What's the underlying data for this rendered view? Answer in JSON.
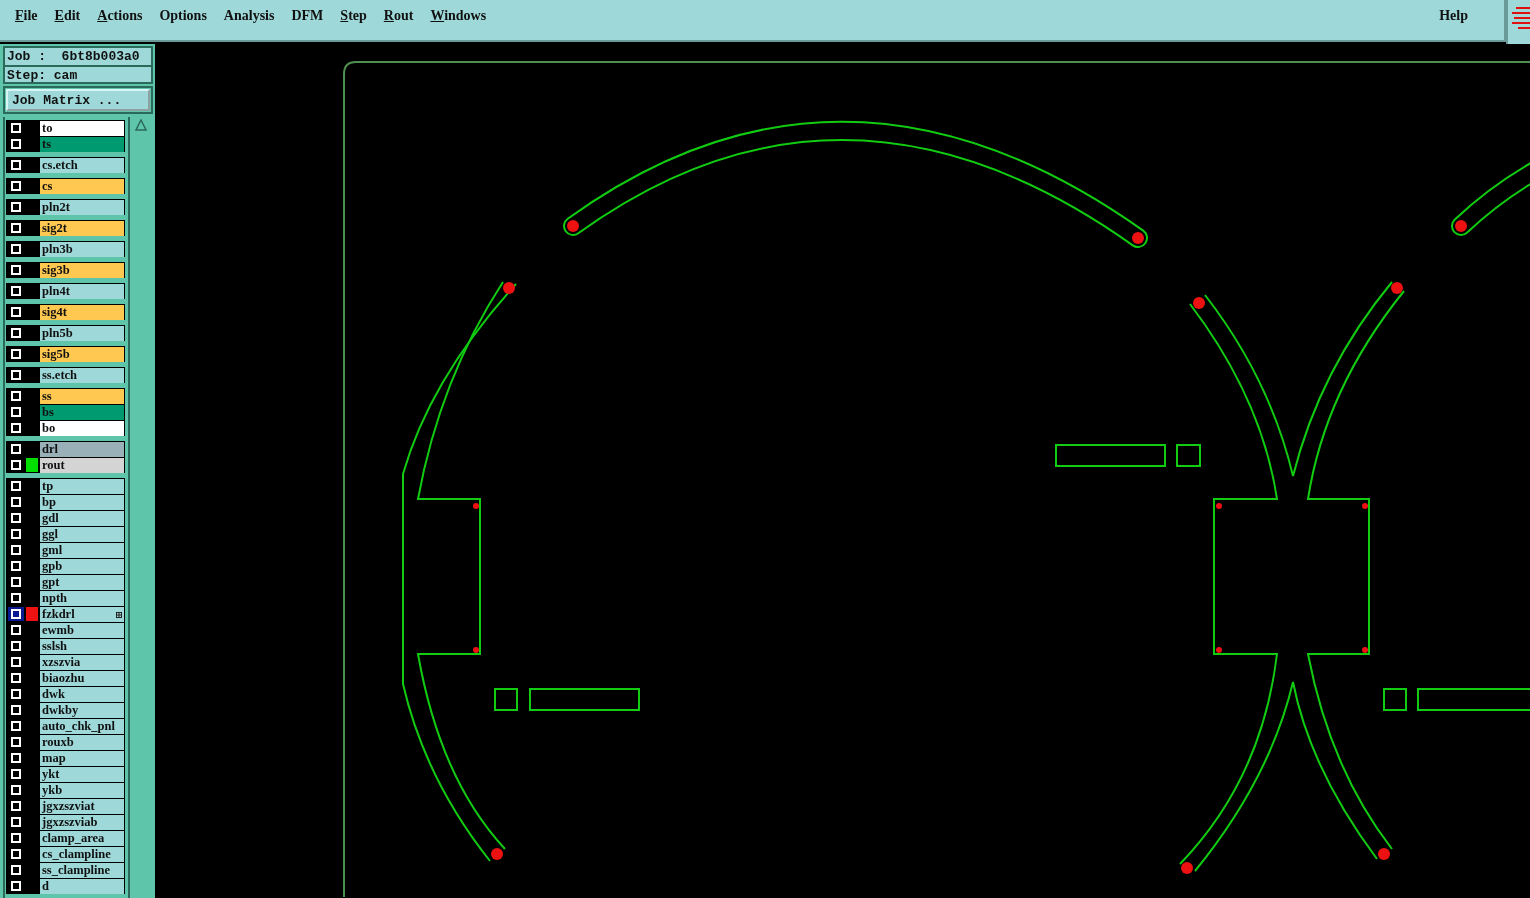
{
  "menu_bar": {
    "items": [
      {
        "label": "File",
        "underlined": true
      },
      {
        "label": "Edit",
        "underlined": true
      },
      {
        "label": "Actions",
        "underlined": true
      },
      {
        "label": "Options",
        "underlined": false
      },
      {
        "label": "Analysis",
        "underlined": false
      },
      {
        "label": "DFM",
        "underlined": false
      },
      {
        "label": "Step",
        "underlined": true
      },
      {
        "label": "Rout",
        "underlined": true
      },
      {
        "label": "Windows",
        "underlined": true
      }
    ],
    "help": "Help"
  },
  "job_info": {
    "job": "Job :  6bt8b003a0",
    "step": "Step: cam"
  },
  "job_matrix_button": "Job Matrix ...",
  "layer_groups": [
    {
      "layers": [
        {
          "name": "to",
          "color": "#ffffff",
          "selected": false
        },
        {
          "name": "ts",
          "color": "#009a70",
          "selected": false
        }
      ]
    },
    {
      "layers": [
        {
          "name": "cs.etch",
          "color": "#9ed8d8",
          "selected": false
        }
      ]
    },
    {
      "layers": [
        {
          "name": "cs",
          "color": "#ffc850",
          "selected": false
        }
      ]
    },
    {
      "layers": [
        {
          "name": "pln2t",
          "color": "#9ed8d8",
          "selected": false
        }
      ]
    },
    {
      "layers": [
        {
          "name": "sig2t",
          "color": "#ffc850",
          "selected": false
        }
      ]
    },
    {
      "layers": [
        {
          "name": "pln3b",
          "color": "#9ed8d8",
          "selected": false
        }
      ]
    },
    {
      "layers": [
        {
          "name": "sig3b",
          "color": "#ffc850",
          "selected": false
        }
      ]
    },
    {
      "layers": [
        {
          "name": "pln4t",
          "color": "#9ed8d8",
          "selected": false
        }
      ]
    },
    {
      "layers": [
        {
          "name": "sig4t",
          "color": "#ffc850",
          "selected": false
        }
      ]
    },
    {
      "layers": [
        {
          "name": "pln5b",
          "color": "#9ed8d8",
          "selected": false
        }
      ]
    },
    {
      "layers": [
        {
          "name": "sig5b",
          "color": "#ffc850",
          "selected": false
        }
      ]
    },
    {
      "layers": [
        {
          "name": "ss.etch",
          "color": "#9ed8d8",
          "selected": false
        }
      ]
    },
    {
      "layers": [
        {
          "name": "ss",
          "color": "#ffc850",
          "selected": false
        },
        {
          "name": "bs",
          "color": "#009a70",
          "selected": false
        },
        {
          "name": "bo",
          "color": "#ffffff",
          "selected": false
        }
      ]
    },
    {
      "layers": [
        {
          "name": "drl",
          "color": "#9ab0b8",
          "selected": false
        },
        {
          "name": "rout",
          "color": "#d4d4d4",
          "selected": false,
          "indicator": {
            "color": "#00dd00"
          }
        }
      ]
    },
    {
      "layers": [
        {
          "name": "tp",
          "color": "#9ed8d8",
          "selected": false
        },
        {
          "name": "bp",
          "color": "#9ed8d8",
          "selected": false
        },
        {
          "name": "gdl",
          "color": "#9ed8d8",
          "selected": false
        },
        {
          "name": "ggl",
          "color": "#9ed8d8",
          "selected": false
        },
        {
          "name": "gml",
          "color": "#9ed8d8",
          "selected": false
        },
        {
          "name": "gpb",
          "color": "#9ed8d8",
          "selected": false
        },
        {
          "name": "gpt",
          "color": "#9ed8d8",
          "selected": false
        },
        {
          "name": "npth",
          "color": "#9ed8d8",
          "selected": false
        },
        {
          "name": "fzkdrl",
          "color": "#9ed8d8",
          "selected": true,
          "indicator": {
            "color": "#ee1111"
          }
        },
        {
          "name": "ewmb",
          "color": "#9ed8d8",
          "selected": false
        },
        {
          "name": "sslsh",
          "color": "#9ed8d8",
          "selected": false
        },
        {
          "name": "xzszvia",
          "color": "#9ed8d8",
          "selected": false
        },
        {
          "name": "biaozhu",
          "color": "#9ed8d8",
          "selected": false
        },
        {
          "name": "dwk",
          "color": "#9ed8d8",
          "selected": false
        },
        {
          "name": "dwkby",
          "color": "#9ed8d8",
          "selected": false
        },
        {
          "name": "auto_chk_pnl",
          "color": "#9ed8d8",
          "selected": false
        },
        {
          "name": "rouxb",
          "color": "#9ed8d8",
          "selected": false
        },
        {
          "name": "map",
          "color": "#9ed8d8",
          "selected": false
        },
        {
          "name": "ykt",
          "color": "#9ed8d8",
          "selected": false
        },
        {
          "name": "ykb",
          "color": "#9ed8d8",
          "selected": false
        },
        {
          "name": "jgxzszviat",
          "color": "#9ed8d8",
          "selected": false
        },
        {
          "name": "jgxzszviab",
          "color": "#9ed8d8",
          "selected": false
        },
        {
          "name": "clamp_area",
          "color": "#9ed8d8",
          "selected": false
        },
        {
          "name": "cs_clampline",
          "color": "#9ed8d8",
          "selected": false
        },
        {
          "name": "ss_clampline",
          "color": "#9ed8d8",
          "selected": false
        },
        {
          "name": "d",
          "color": "#9ed8d8",
          "selected": false
        }
      ]
    }
  ]
}
